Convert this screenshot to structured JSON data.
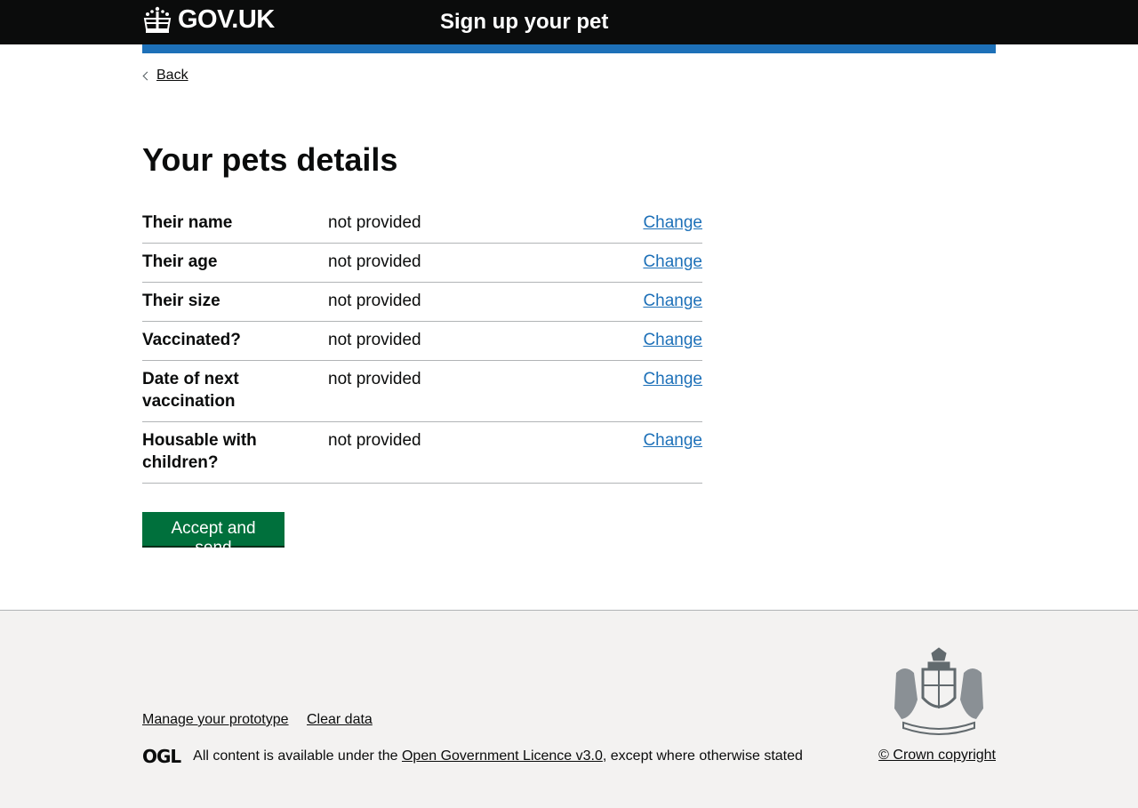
{
  "header": {
    "logo_text": "GOV.UK",
    "service_name": "Sign up your pet"
  },
  "nav": {
    "back_label": "Back"
  },
  "page": {
    "title": "Your pets details"
  },
  "summary": {
    "rows": [
      {
        "key": "Their name",
        "value": "not provided",
        "action": "Change"
      },
      {
        "key": "Their age",
        "value": "not provided",
        "action": "Change"
      },
      {
        "key": "Their size",
        "value": "not provided",
        "action": "Change"
      },
      {
        "key": "Vaccinated?",
        "value": "not provided",
        "action": "Change"
      },
      {
        "key": "Date of next vaccination",
        "value": "not provided",
        "action": "Change"
      },
      {
        "key": "Housable with children?",
        "value": "not provided",
        "action": "Change"
      }
    ]
  },
  "submit": {
    "label": "Accept and send"
  },
  "footer": {
    "links": [
      "Manage your prototype",
      "Clear data"
    ],
    "ogl_label": "OGL",
    "licence_prefix": "All content is available under the ",
    "licence_link": "Open Government Licence v3.0",
    "licence_suffix": ", except where otherwise stated",
    "copyright": "© Crown copyright"
  },
  "colors": {
    "header_bg": "#0b0c0c",
    "accent_blue": "#1d70b8",
    "button_green": "#00703c",
    "footer_bg": "#f3f2f1"
  }
}
